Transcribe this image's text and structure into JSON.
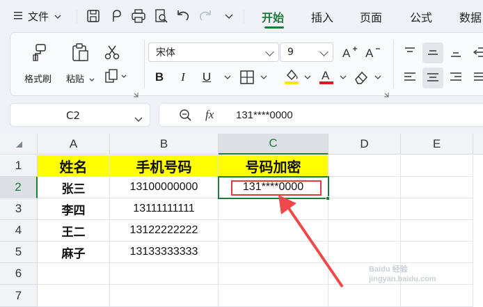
{
  "menubar": {
    "file_label": "文件",
    "tabs": [
      "开始",
      "插入",
      "页面",
      "公式",
      "数据"
    ]
  },
  "ribbon": {
    "format_painter_label": "格式刷",
    "paste_label": "粘贴",
    "font_name": "宋体",
    "font_size": "9",
    "bold": "B",
    "italic": "I",
    "underline": "U"
  },
  "formula_bar": {
    "cell_ref": "C2",
    "fx_label": "fx",
    "content": "131****0000"
  },
  "sheet": {
    "columns": [
      "A",
      "B",
      "C",
      "D",
      "E"
    ],
    "rows": [
      "1",
      "2",
      "3",
      "4",
      "5",
      "6",
      "7"
    ],
    "header_row": [
      "姓名",
      "手机号码",
      "号码加密"
    ],
    "data": [
      {
        "name": "张三",
        "phone": "13100000000",
        "masked": "131****0000"
      },
      {
        "name": "李四",
        "phone": "13111111111",
        "masked": ""
      },
      {
        "name": "王二",
        "phone": "13122222222",
        "masked": ""
      },
      {
        "name": "麻子",
        "phone": "13133333333",
        "masked": ""
      }
    ],
    "selected_cell": "C2"
  },
  "colors": {
    "accent": "#1f7a3c",
    "header_fill": "#ffff00",
    "annotation": "#e03a3a"
  },
  "watermark": "Baidu 经验 jingyan.baidu.com"
}
